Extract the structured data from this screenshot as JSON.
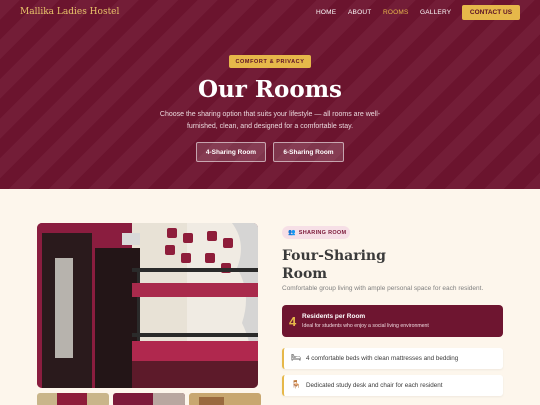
{
  "nav": {
    "brand": "Mallika Ladies Hostel",
    "links": [
      "HOME",
      "ABOUT",
      "ROOMS",
      "GALLERY"
    ],
    "active": "ROOMS",
    "contact": "CONTACT US"
  },
  "hero": {
    "badge": "COMFORT & PRIVACY",
    "title": "Our Rooms",
    "description": "Choose the sharing option that suits your lifestyle — all rooms are well-furnished, clean, and designed for a comfortable stay.",
    "buttons": [
      "4-Sharing Room",
      "6-Sharing Room"
    ]
  },
  "room": {
    "pill": "SHARING ROOM",
    "pill_icon": "people-icon",
    "title": "Four-Sharing Room",
    "description": "Comfortable group living with ample personal space for each resident.",
    "residents": {
      "number": "4",
      "title": "Residents per Room",
      "subtitle": "Ideal for students who enjoy a social living environment"
    },
    "features": [
      {
        "icon": "bed-icon",
        "text": "4 comfortable beds with clean mattresses and bedding"
      },
      {
        "icon": "desk-chair-icon",
        "text": "Dedicated study desk and chair for each resident"
      }
    ]
  },
  "colors": {
    "maroon": "#6e1530",
    "gold": "#e6b84a",
    "cream": "#fdf6ec"
  }
}
